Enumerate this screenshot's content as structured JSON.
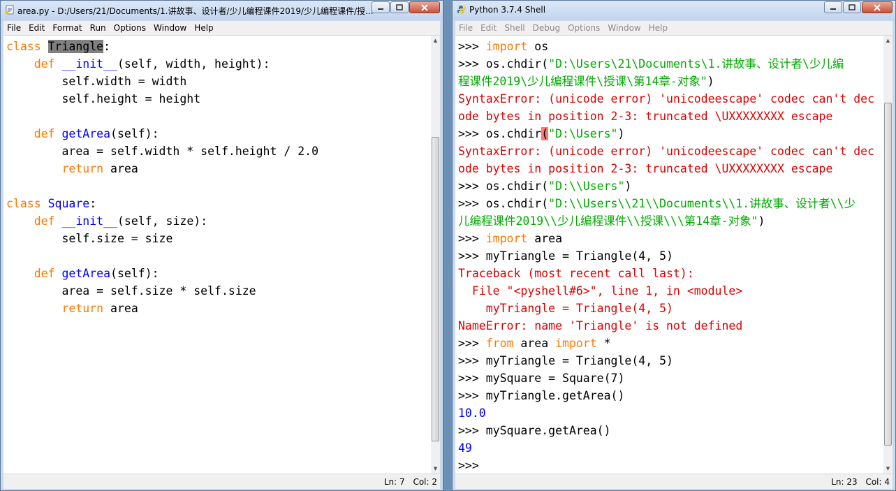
{
  "editor": {
    "title": "area.py - D:/Users/21/Documents/1.讲故事、设计者/少儿编程课件2019/少儿编程课件/授...",
    "menu": [
      "File",
      "Edit",
      "Format",
      "Run",
      "Options",
      "Window",
      "Help"
    ],
    "status": {
      "line": "Ln: 7",
      "col": "Col: 2"
    },
    "scroll_arrows": {
      "up": "▲",
      "down": "▼"
    },
    "code": [
      [
        [
          "class ",
          "kw"
        ],
        [
          "Triangle",
          "sel"
        ],
        [
          ":",
          ""
        ]
      ],
      [
        [
          "    ",
          ""
        ],
        [
          "def ",
          "kw"
        ],
        [
          "__init__",
          "def"
        ],
        [
          "(self, width, height):",
          ""
        ]
      ],
      [
        [
          "        self.width = width",
          ""
        ]
      ],
      [
        [
          "        self.height = height",
          ""
        ]
      ],
      [
        [
          "",
          ""
        ]
      ],
      [
        [
          "    ",
          ""
        ],
        [
          "def ",
          "kw"
        ],
        [
          "getArea",
          "def"
        ],
        [
          "(self):",
          ""
        ]
      ],
      [
        [
          "        area = self.width * self.height / 2.0",
          ""
        ]
      ],
      [
        [
          "        ",
          ""
        ],
        [
          "return ",
          "kw"
        ],
        [
          "area",
          ""
        ]
      ],
      [
        [
          "",
          ""
        ]
      ],
      [
        [
          "class ",
          "kw"
        ],
        [
          "Square",
          "def"
        ],
        [
          ":",
          ""
        ]
      ],
      [
        [
          "    ",
          ""
        ],
        [
          "def ",
          "kw"
        ],
        [
          "__init__",
          "def"
        ],
        [
          "(self, size):",
          ""
        ]
      ],
      [
        [
          "        self.size = size",
          ""
        ]
      ],
      [
        [
          "",
          ""
        ]
      ],
      [
        [
          "    ",
          ""
        ],
        [
          "def ",
          "kw"
        ],
        [
          "getArea",
          "def"
        ],
        [
          "(self):",
          ""
        ]
      ],
      [
        [
          "        area = self.size * self.size",
          ""
        ]
      ],
      [
        [
          "        ",
          ""
        ],
        [
          "return ",
          "kw"
        ],
        [
          "area",
          ""
        ]
      ]
    ]
  },
  "shell": {
    "title": "Python 3.7.4 Shell",
    "menu": [
      "File",
      "Edit",
      "Shell",
      "Debug",
      "Options",
      "Window",
      "Help"
    ],
    "status": {
      "line": "Ln: 23",
      "col": "Col: 4"
    },
    "scroll_arrows": {
      "up": "▲",
      "down": "▼"
    },
    "lines": [
      [
        [
          ">>> ",
          ""
        ],
        [
          "import ",
          "kw"
        ],
        [
          "os",
          ""
        ]
      ],
      [
        [
          ">>> os.chdir(",
          ""
        ],
        [
          "\"D:\\Users\\21\\Documents\\1.讲故事、设计者\\少儿编",
          "str"
        ]
      ],
      [
        [
          "程课件2019\\少儿编程课件\\授课\\第14章-对象\"",
          "str"
        ],
        [
          ")",
          ""
        ]
      ],
      [
        [
          "SyntaxError: (unicode error) 'unicodeescape' codec can't dec",
          "err"
        ]
      ],
      [
        [
          "ode bytes in position 2-3: truncated \\UXXXXXXXX escape",
          "err"
        ]
      ],
      [
        [
          ">>> os.chdir",
          ""
        ],
        [
          "(",
          "errmark"
        ],
        [
          "\"D:\\Users\"",
          "str"
        ],
        [
          ")",
          ""
        ]
      ],
      [
        [
          "SyntaxError: (unicode error) 'unicodeescape' codec can't dec",
          "err"
        ]
      ],
      [
        [
          "ode bytes in position 2-3: truncated \\UXXXXXXXX escape",
          "err"
        ]
      ],
      [
        [
          ">>> os.chdir(",
          ""
        ],
        [
          "\"D:\\\\Users\"",
          "str"
        ],
        [
          ")",
          ""
        ]
      ],
      [
        [
          ">>> os.chdir(",
          ""
        ],
        [
          "\"D:\\\\Users\\\\21\\\\Documents\\\\1.讲故事、设计者\\\\少",
          "str"
        ]
      ],
      [
        [
          "儿编程课件2019\\\\少儿编程课件\\\\授课\\\\\\第14章-对象\"",
          "str"
        ],
        [
          ")",
          ""
        ]
      ],
      [
        [
          ">>> ",
          ""
        ],
        [
          "import ",
          "kw"
        ],
        [
          "area",
          ""
        ]
      ],
      [
        [
          ">>> myTriangle = Triangle(4, 5)",
          ""
        ]
      ],
      [
        [
          "Traceback (most recent call last):",
          "err"
        ]
      ],
      [
        [
          "  File \"<pyshell#6>\", line 1, in <module>",
          "err"
        ]
      ],
      [
        [
          "    myTriangle = Triangle(4, 5)",
          "err"
        ]
      ],
      [
        [
          "NameError: name 'Triangle' is not defined",
          "err"
        ]
      ],
      [
        [
          ">>> ",
          ""
        ],
        [
          "from ",
          "kw"
        ],
        [
          "area ",
          ""
        ],
        [
          "import ",
          "kw"
        ],
        [
          "*",
          ""
        ]
      ],
      [
        [
          ">>> myTriangle = Triangle(4, 5)",
          ""
        ]
      ],
      [
        [
          ">>> mySquare = Square(7)",
          ""
        ]
      ],
      [
        [
          ">>> myTriangle.getArea()",
          ""
        ]
      ],
      [
        [
          "10.0",
          "out"
        ]
      ],
      [
        [
          ">>> mySquare.getArea()",
          ""
        ]
      ],
      [
        [
          "49",
          "out"
        ]
      ],
      [
        [
          ">>> ",
          ""
        ]
      ]
    ]
  }
}
